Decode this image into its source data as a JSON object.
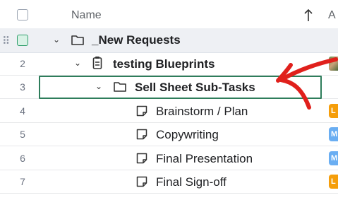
{
  "header": {
    "name_label": "Name",
    "sort_icon": "arrow-up-icon",
    "next_col_partial": "A"
  },
  "rows": [
    {
      "num": "",
      "label": "_New Requests",
      "icon": "folder-icon"
    },
    {
      "num": "2",
      "label": "testing Blueprints",
      "icon": "clipboard-icon"
    },
    {
      "num": "3",
      "label": "Sell Sheet Sub-Tasks",
      "icon": "folder-icon"
    },
    {
      "num": "4",
      "label": "Brainstorm / Plan",
      "icon": "task-note-icon",
      "chip": "L"
    },
    {
      "num": "5",
      "label": "Copywriting",
      "icon": "task-note-icon",
      "chip": "M"
    },
    {
      "num": "6",
      "label": "Final Presentation",
      "icon": "task-note-icon",
      "chip": "M"
    },
    {
      "num": "7",
      "label": "Final Sign-off",
      "icon": "task-note-icon",
      "chip": "L"
    }
  ],
  "colors": {
    "accent_green": "#2e7d5b",
    "chip_orange": "#f59e0b",
    "chip_blue": "#6aaef2",
    "annotation_red": "#e0201c"
  }
}
